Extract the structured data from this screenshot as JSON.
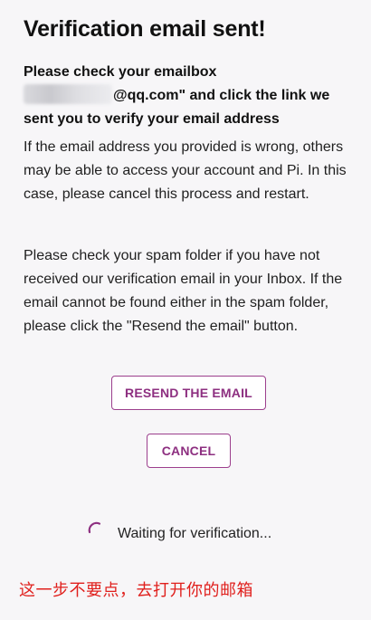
{
  "header": {
    "title": "Verification email sent!"
  },
  "notice": {
    "line_start": "Please check your emailbox",
    "email_suffix": "@qq.com\" and click the link we sent you to verify your email address"
  },
  "body": {
    "paragraph_1": "If the email address you provided is wrong, others may be able to access your account and Pi. In this case, please cancel this process and restart.",
    "paragraph_2": "Please check your spam folder if you have not received our verification email in your Inbox. If the email cannot be found either in the spam folder, please click the \"Resend the email\" button."
  },
  "actions": {
    "resend_label": "RESEND THE EMAIL",
    "cancel_label": "CANCEL"
  },
  "status": {
    "waiting_text": "Waiting for verification..."
  },
  "annotation": {
    "text": "这一步不要点，去打开你的邮箱"
  },
  "colors": {
    "accent": "#8d2f80",
    "annotation": "#e0201d",
    "background": "#f7f6f8"
  },
  "icons": {
    "spinner": "loading-spinner-icon"
  }
}
